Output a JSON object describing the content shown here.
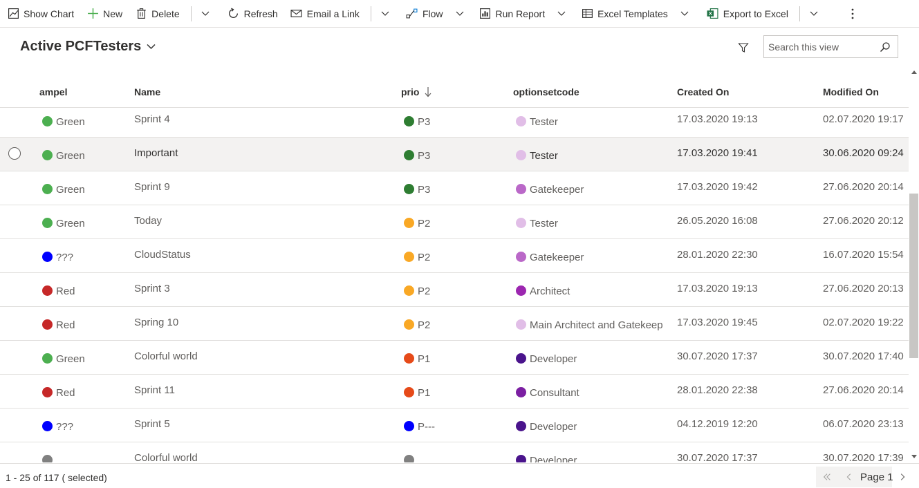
{
  "commandbar": {
    "show_chart": "Show Chart",
    "new": "New",
    "delete": "Delete",
    "refresh": "Refresh",
    "email_link": "Email a Link",
    "flow": "Flow",
    "run_report": "Run Report",
    "excel_templates": "Excel Templates",
    "export_excel": "Export to Excel"
  },
  "view": {
    "title": "Active PCFTesters",
    "search_placeholder": "Search this view"
  },
  "columns": {
    "ampel": "ampel",
    "name": "Name",
    "prio": "prio",
    "optionsetcode": "optionsetcode",
    "created": "Created On",
    "modified": "Modified On"
  },
  "colors": {
    "green": "#4caf50",
    "blue": "#0000ff",
    "red": "#c62828",
    "gray": "#808080",
    "prio_p3": "#2e7d32",
    "prio_p2": "#f9a825",
    "prio_p1": "#e64a19",
    "tester": "#e1bee7",
    "gatekeeper": "#ba68c8",
    "architect": "#9c27b0",
    "developer": "#4a148c",
    "consultant": "#7b1fa2"
  },
  "rows": [
    {
      "ampel": "Green",
      "ampel_color": "#4caf50",
      "name": "Sprint 4",
      "prio": "P3",
      "prio_color": "#2e7d32",
      "opt": "Tester",
      "opt_color": "#e1bee7",
      "created": "17.03.2020 19:13",
      "modified": "02.07.2020 19:17"
    },
    {
      "ampel": "Green",
      "ampel_color": "#4caf50",
      "name": "Important",
      "prio": "P3",
      "prio_color": "#2e7d32",
      "opt": "Tester",
      "opt_color": "#e1bee7",
      "created": "17.03.2020 19:41",
      "modified": "30.06.2020 09:24"
    },
    {
      "ampel": "Green",
      "ampel_color": "#4caf50",
      "name": "Sprint 9",
      "prio": "P3",
      "prio_color": "#2e7d32",
      "opt": "Gatekeeper",
      "opt_color": "#ba68c8",
      "created": "17.03.2020 19:42",
      "modified": "27.06.2020 20:14"
    },
    {
      "ampel": "Green",
      "ampel_color": "#4caf50",
      "name": "Today",
      "prio": "P2",
      "prio_color": "#f9a825",
      "opt": "Tester",
      "opt_color": "#e1bee7",
      "created": "26.05.2020 16:08",
      "modified": "27.06.2020 20:12"
    },
    {
      "ampel": "???",
      "ampel_color": "#0000ff",
      "name": "CloudStatus",
      "prio": "P2",
      "prio_color": "#f9a825",
      "opt": "Gatekeeper",
      "opt_color": "#ba68c8",
      "created": "28.01.2020 22:30",
      "modified": "16.07.2020 15:54"
    },
    {
      "ampel": "Red",
      "ampel_color": "#c62828",
      "name": "Sprint 3",
      "prio": "P2",
      "prio_color": "#f9a825",
      "opt": "Architect",
      "opt_color": "#9c27b0",
      "created": "17.03.2020 19:13",
      "modified": "27.06.2020 20:13"
    },
    {
      "ampel": "Red",
      "ampel_color": "#c62828",
      "name": "Spring 10",
      "prio": "P2",
      "prio_color": "#f9a825",
      "opt": "Main Architect and Gatekeep",
      "opt_color": "#e1bee7",
      "created": "17.03.2020 19:45",
      "modified": "02.07.2020 19:22"
    },
    {
      "ampel": "Green",
      "ampel_color": "#4caf50",
      "name": "Colorful world",
      "prio": "P1",
      "prio_color": "#e64a19",
      "opt": "Developer",
      "opt_color": "#4a148c",
      "created": "30.07.2020 17:37",
      "modified": "30.07.2020 17:40"
    },
    {
      "ampel": "Red",
      "ampel_color": "#c62828",
      "name": "Sprint 11",
      "prio": "P1",
      "prio_color": "#e64a19",
      "opt": "Consultant",
      "opt_color": "#7b1fa2",
      "created": "28.01.2020 22:38",
      "modified": "27.06.2020 20:14"
    },
    {
      "ampel": "???",
      "ampel_color": "#0000ff",
      "name": "Sprint 5",
      "prio": "P---",
      "prio_color": "#0000ff",
      "opt": "Developer",
      "opt_color": "#4a148c",
      "created": "04.12.2019 12:20",
      "modified": "06.07.2020 23:13"
    },
    {
      "ampel": "",
      "ampel_color": "#808080",
      "name": "Colorful world",
      "prio": "",
      "prio_color": "#808080",
      "opt": "Developer",
      "opt_color": "#4a148c",
      "created": "30.07.2020 17:37",
      "modified": "30.07.2020 17:39"
    }
  ],
  "footer": {
    "count": "1 - 25 of 117 ( selected)",
    "page": "Page 1"
  }
}
